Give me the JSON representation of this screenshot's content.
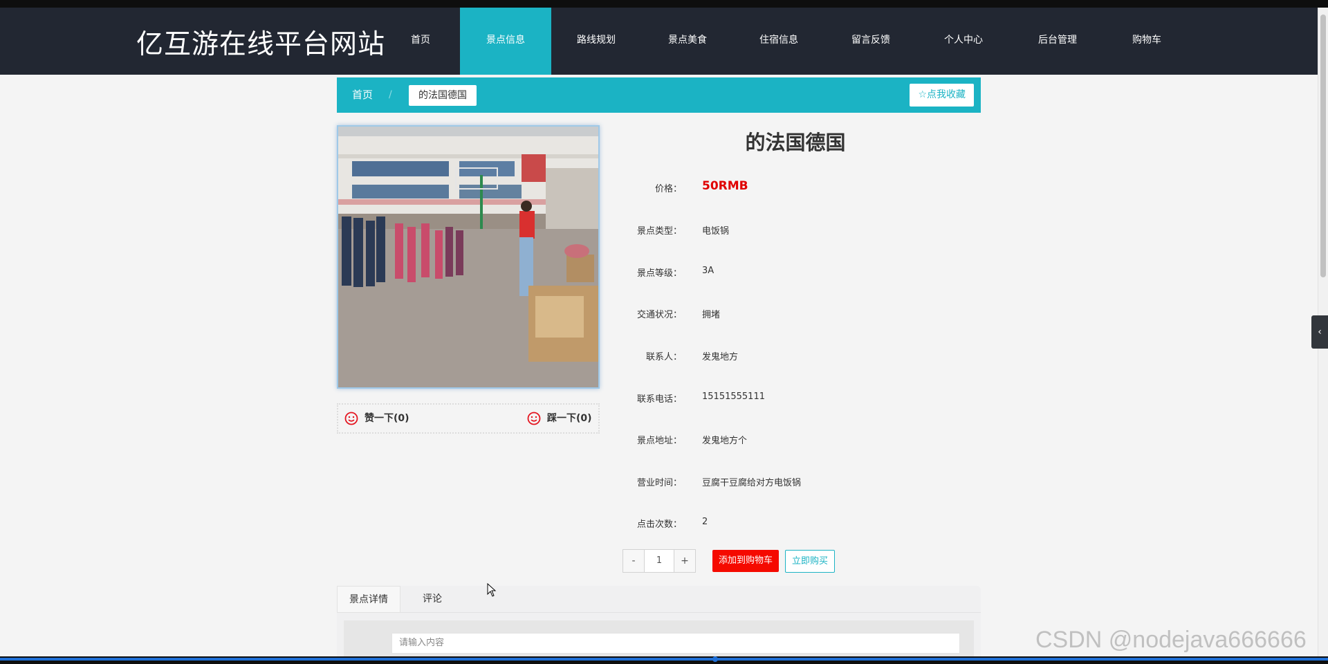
{
  "site": {
    "title": "亿互游在线平台网站"
  },
  "nav": {
    "items": [
      {
        "label": "首页"
      },
      {
        "label": "景点信息"
      },
      {
        "label": "路线规划"
      },
      {
        "label": "景点美食"
      },
      {
        "label": "住宿信息"
      },
      {
        "label": "留言反馈"
      },
      {
        "label": "个人中心"
      },
      {
        "label": "后台管理"
      },
      {
        "label": "购物车"
      }
    ],
    "active": "景点信息"
  },
  "breadcrumb": {
    "home": "首页",
    "separator": "/",
    "current": "的法国德国",
    "favorite": "☆点我收藏"
  },
  "votes": {
    "like": "赞一下(0)",
    "dislike": "踩一下(0)"
  },
  "detail": {
    "title": "的法国德国",
    "fields": [
      {
        "label": "价格：",
        "value": "50RMB"
      },
      {
        "label": "景点类型：",
        "value": "电饭锅"
      },
      {
        "label": "景点等级：",
        "value": "3A"
      },
      {
        "label": "交通状况：",
        "value": "拥堵"
      },
      {
        "label": "联系人：",
        "value": "发鬼地方"
      },
      {
        "label": "联系电话：",
        "value": "15151555111"
      },
      {
        "label": "景点地址：",
        "value": "发鬼地方个"
      },
      {
        "label": "营业时间：",
        "value": "豆腐干豆腐给对方电饭锅"
      },
      {
        "label": "点击次数：",
        "value": "2"
      }
    ]
  },
  "purchase": {
    "minus": "-",
    "quantity": "1",
    "plus": "+",
    "add_to_cart": "添加到购物车",
    "buy_now": "立即购买"
  },
  "tabs": {
    "items": [
      {
        "label": "景点详情"
      },
      {
        "label": "评论"
      }
    ],
    "active": "景点详情"
  },
  "comment": {
    "placeholder": "请输入内容"
  },
  "watermark": "CSDN @nodejava666666",
  "colors": {
    "nav_bg": "#222732",
    "accent": "#1bb3c4",
    "price": "#e00000",
    "add_cart": "#f50a00"
  }
}
